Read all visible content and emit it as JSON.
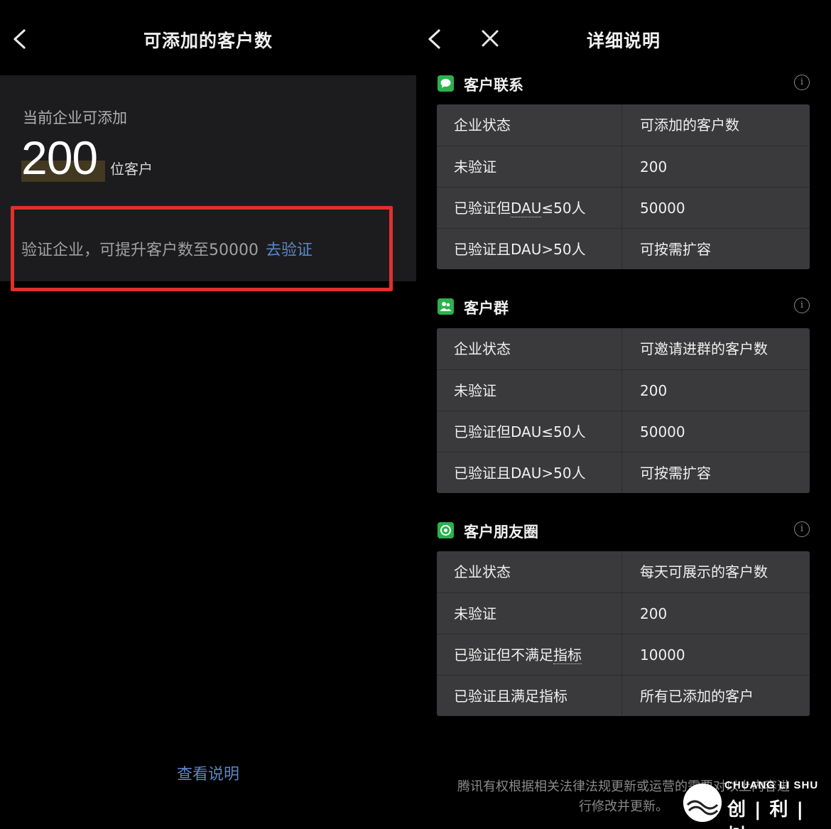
{
  "left": {
    "nav": {
      "back_icon": "chevron-left-icon",
      "title": "可添加的客户数"
    },
    "current_caption": "当前企业可添加",
    "count": "200",
    "count_unit": "位客户",
    "verify_text": "验证企业，可提升客户数至50000",
    "verify_link": "去验证",
    "see_more": "查看说明",
    "highlight_color": "#e0302c",
    "link_color": "#5b86c5"
  },
  "right": {
    "nav": {
      "back_icon": "chevron-left-icon",
      "close_icon": "close-icon",
      "title": "详细说明"
    },
    "sections": [
      {
        "name": "客户联系",
        "icon": "chat-bubble-icon",
        "header": [
          "企业状态",
          "可添加的客户数"
        ],
        "rows": [
          [
            "未验证",
            "200"
          ],
          [
            "已验证但DAU≤50人",
            "50000"
          ],
          [
            "已验证且DAU>50人",
            "可按需扩容"
          ]
        ]
      },
      {
        "name": "客户群",
        "icon": "group-icon",
        "header": [
          "企业状态",
          "可邀请进群的客户数"
        ],
        "rows": [
          [
            "未验证",
            "200"
          ],
          [
            "已验证但DAU≤50人",
            "50000"
          ],
          [
            "已验证且DAU>50人",
            "可按需扩容"
          ]
        ]
      },
      {
        "name": "客户朋友圈",
        "icon": "moments-icon",
        "header": [
          "企业状态",
          "每天可展示的客户数"
        ],
        "rows": [
          [
            "未验证",
            "200"
          ],
          [
            "已验证但不满足指标",
            "10000"
          ],
          [
            "已验证且满足指标",
            "所有已添加的客户"
          ]
        ]
      }
    ],
    "footer_line1": "腾讯有权根据相关法律法规更新或运营的需要对以上内容进",
    "footer_line2": "行修改并更新。",
    "brand_en": "CHUANG LI SHU",
    "brand_cn": "创|利|树",
    "accent_green": "#2bb24c"
  }
}
